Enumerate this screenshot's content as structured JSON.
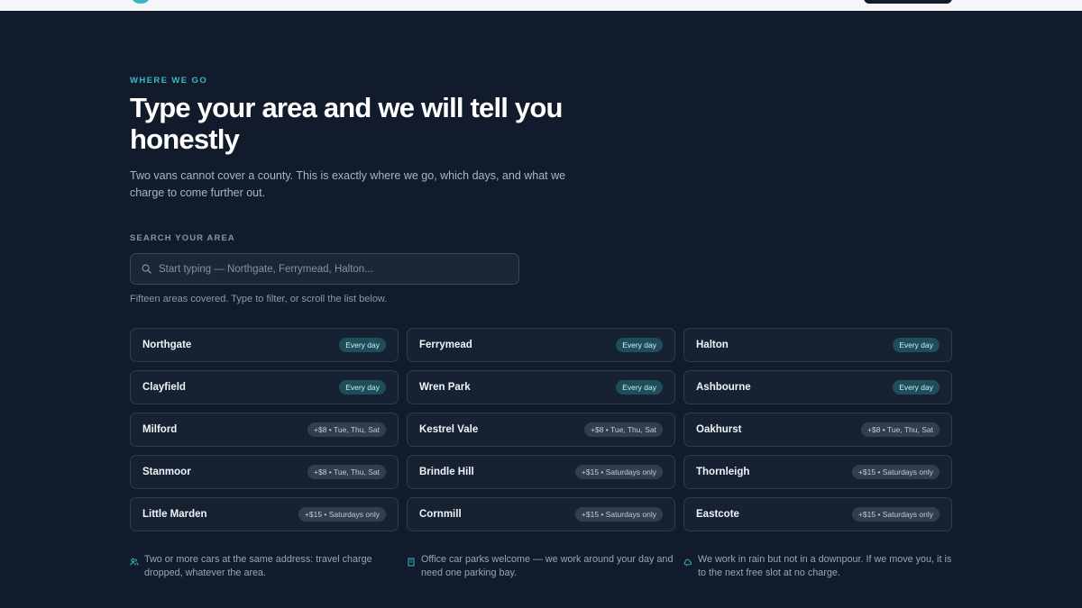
{
  "header": {
    "eyebrow": "WHERE WE GO",
    "title": "Type your area and we will tell you honestly",
    "lede": "Two vans cannot cover a county. This is exactly where we go, which days, and what we charge to come further out."
  },
  "search": {
    "label": "SEARCH YOUR AREA",
    "placeholder": "Start typing — Northgate, Ferrymead, Halton...",
    "value": "",
    "hint": "Fifteen areas covered. Type to filter, or scroll the list below."
  },
  "areas": [
    {
      "name": "Northgate",
      "badge": "Every day",
      "kind": "every"
    },
    {
      "name": "Ferrymead",
      "badge": "Every day",
      "kind": "every"
    },
    {
      "name": "Halton",
      "badge": "Every day",
      "kind": "every"
    },
    {
      "name": "Clayfield",
      "badge": "Every day",
      "kind": "every"
    },
    {
      "name": "Wren Park",
      "badge": "Every day",
      "kind": "every"
    },
    {
      "name": "Ashbourne",
      "badge": "Every day",
      "kind": "every"
    },
    {
      "name": "Milford",
      "badge": "+$8 • Tue, Thu, Sat",
      "kind": "extra"
    },
    {
      "name": "Kestrel Vale",
      "badge": "+$8 • Tue, Thu, Sat",
      "kind": "extra"
    },
    {
      "name": "Oakhurst",
      "badge": "+$8 • Tue, Thu, Sat",
      "kind": "extra"
    },
    {
      "name": "Stanmoor",
      "badge": "+$8 • Tue, Thu, Sat",
      "kind": "extra"
    },
    {
      "name": "Brindle Hill",
      "badge": "+$15 • Saturdays only",
      "kind": "extra"
    },
    {
      "name": "Thornleigh",
      "badge": "+$15 • Saturdays only",
      "kind": "extra"
    },
    {
      "name": "Little Marden",
      "badge": "+$15 • Saturdays only",
      "kind": "extra"
    },
    {
      "name": "Cornmill",
      "badge": "+$15 • Saturdays only",
      "kind": "extra"
    },
    {
      "name": "Eastcote",
      "badge": "+$15 • Saturdays only",
      "kind": "extra"
    }
  ],
  "notes": [
    {
      "icon": "people-icon",
      "text": "Two or more cars at the same address: travel charge dropped, whatever the area."
    },
    {
      "icon": "building-icon",
      "text": "Office car parks welcome — we work around your day and need one parking bay."
    },
    {
      "icon": "rain-icon",
      "text": "We work in rain but not in a downpour. If we move you, it is to the next free slot at no charge."
    }
  ],
  "colors": {
    "background": "#111b2b",
    "accent": "#3bb9c4",
    "badge_every_bg": "#1f4d5a",
    "badge_extra_bg": "#323d4d"
  }
}
